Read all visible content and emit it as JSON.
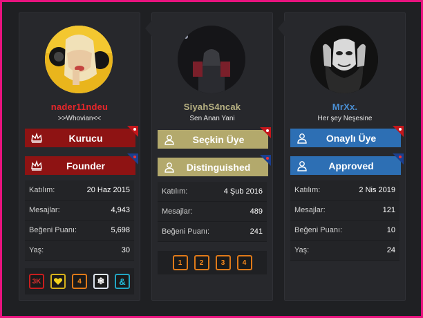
{
  "cards": [
    {
      "username": "nader11ndeu",
      "username_color": "#e8262a",
      "title": ">>Whovian<<",
      "banners": [
        {
          "label": "Kurucu",
          "color": "#8e1313",
          "icon": "crown-icon"
        },
        {
          "label": "Founder",
          "color": "#8e1313",
          "icon": "crown-icon"
        }
      ],
      "stats": [
        {
          "label": "Katılım:",
          "value": "20 Haz 2015"
        },
        {
          "label": "Mesajlar:",
          "value": "4,943"
        },
        {
          "label": "Beğeni Puanı:",
          "value": "5,698"
        },
        {
          "label": "Yaş:",
          "value": "30"
        }
      ],
      "badges": [
        "3K",
        "heart",
        "4",
        "snowflake",
        "&"
      ]
    },
    {
      "username": "SiyahS4ncak",
      "username_color": "#b8b283",
      "title": "Sen Anan Yani",
      "banners": [
        {
          "label": "Seçkin Üye",
          "color": "#b3a96c",
          "icon": "user-icon"
        },
        {
          "label": "Distinguished",
          "color": "#b3a96c",
          "icon": "user-icon"
        }
      ],
      "stats": [
        {
          "label": "Katılım:",
          "value": "4 Şub 2016"
        },
        {
          "label": "Mesajlar:",
          "value": "489"
        },
        {
          "label": "Beğeni Puanı:",
          "value": "241"
        }
      ],
      "badges": [
        "1",
        "2",
        "3",
        "4"
      ]
    },
    {
      "username": "MrXx.",
      "username_color": "#4a8fd4",
      "title": "Her şey Neşesine",
      "banners": [
        {
          "label": "Onaylı Üye",
          "color": "#2d6fb4",
          "icon": "user-icon"
        },
        {
          "label": "Approved",
          "color": "#2d6fb4",
          "icon": "user-icon"
        }
      ],
      "stats": [
        {
          "label": "Katılım:",
          "value": "2 Nis 2019"
        },
        {
          "label": "Mesajlar:",
          "value": "121"
        },
        {
          "label": "Beğeni Puanı:",
          "value": "10"
        },
        {
          "label": "Yaş:",
          "value": "24"
        }
      ],
      "badges": []
    }
  ]
}
